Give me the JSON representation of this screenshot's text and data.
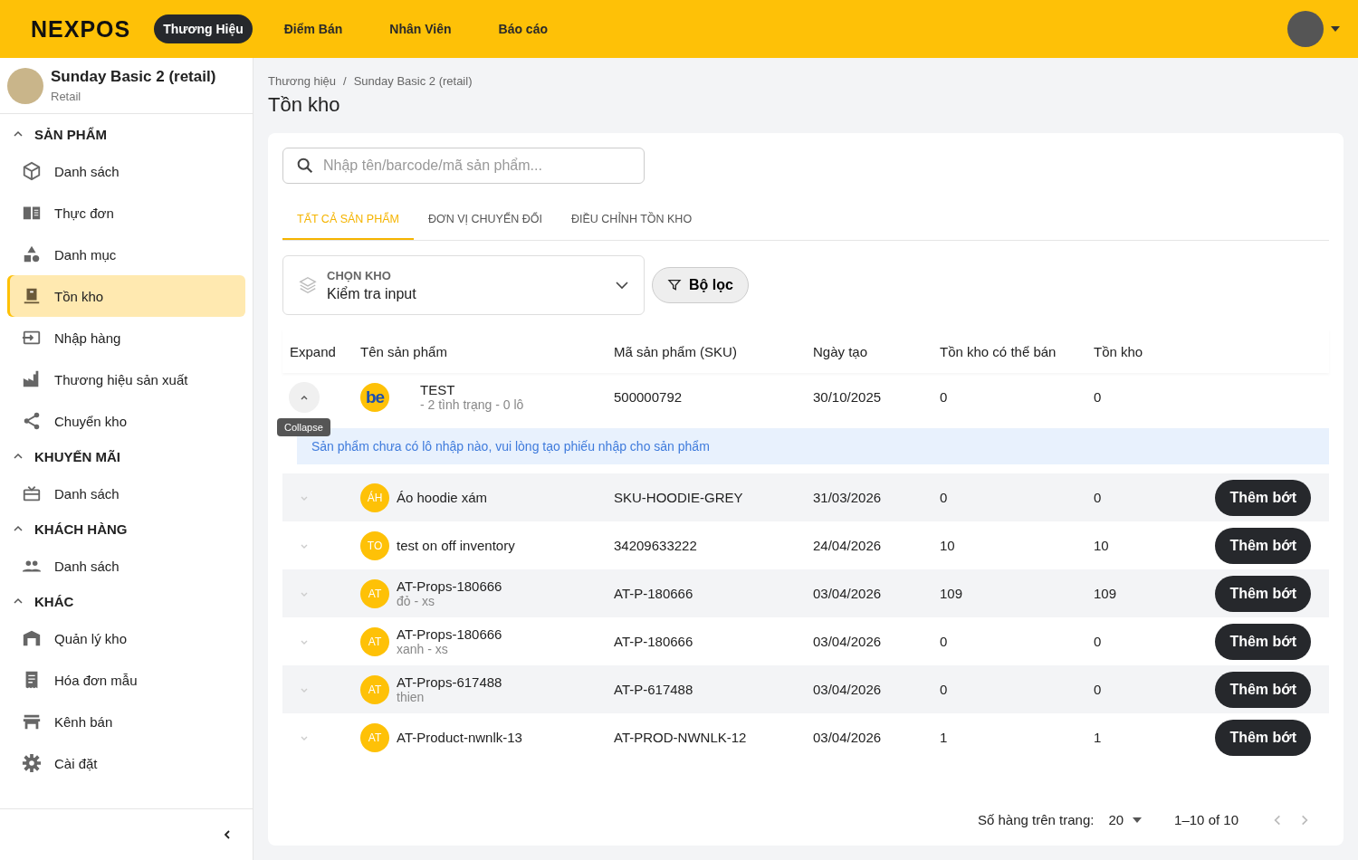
{
  "header": {
    "logo": "NEXPOS",
    "nav": [
      {
        "label": "Thương Hiệu",
        "selected": true
      },
      {
        "label": "Điểm Bán",
        "selected": false
      },
      {
        "label": "Nhân Viên",
        "selected": false
      },
      {
        "label": "Báo cáo",
        "selected": false
      }
    ]
  },
  "sidebar": {
    "store": {
      "name": "Sunday Basic 2 (retail)",
      "type": "Retail"
    },
    "sections": [
      {
        "title": "SẢN PHẨM",
        "expanded": true,
        "items": [
          {
            "label": "Danh sách",
            "selected": false
          },
          {
            "label": "Thực đơn",
            "selected": false
          },
          {
            "label": "Danh mục",
            "selected": false
          },
          {
            "label": "Tồn kho",
            "selected": true
          },
          {
            "label": "Nhập hàng",
            "selected": false
          },
          {
            "label": "Thương hiệu sản xuất",
            "selected": false
          },
          {
            "label": "Chuyển kho",
            "selected": false
          }
        ]
      },
      {
        "title": "KHUYẾN MÃI",
        "expanded": true,
        "items": [
          {
            "label": "Danh sách",
            "selected": false
          }
        ]
      },
      {
        "title": "KHÁCH HÀNG",
        "expanded": true,
        "items": [
          {
            "label": "Danh sách",
            "selected": false
          }
        ]
      },
      {
        "title": "KHÁC",
        "expanded": true,
        "items": [
          {
            "label": "Quản lý kho",
            "selected": false
          },
          {
            "label": "Hóa đơn mẫu",
            "selected": false
          },
          {
            "label": "Kênh bán",
            "selected": false
          },
          {
            "label": "Cài đặt",
            "selected": false
          }
        ]
      }
    ]
  },
  "breadcrumb": [
    "Thương hiệu",
    "Sunday Basic 2 (retail)"
  ],
  "breadcrumb_separator": "/",
  "page_title": "Tồn kho",
  "search": {
    "placeholder": "Nhập tên/barcode/mã sản phẩm..."
  },
  "tabs": [
    {
      "label": "TẤT CẢ SẢN PHẨM",
      "selected": true
    },
    {
      "label": "ĐƠN VỊ CHUYỂN ĐỔI",
      "selected": false
    },
    {
      "label": "ĐIỀU CHỈNH TỒN KHO",
      "selected": false
    }
  ],
  "warehouse_select": {
    "label": "CHỌN KHO",
    "value": "Kiểm tra input"
  },
  "filter_button": "Bộ lọc",
  "table": {
    "columns": [
      "Expand",
      "Tên sản phẩm",
      "Mã sản phẩm (SKU)",
      "Ngày tạo",
      "Tồn kho có thể bán",
      "Tồn kho"
    ],
    "tooltip": "Collapse",
    "rows": [
      {
        "expanded": true,
        "thumb": {
          "kind": "logo",
          "text": "be"
        },
        "name": "TEST",
        "variant": "- 2 tình trạng - 0 lô",
        "sku": "500000792",
        "created": "30/10/2025",
        "sellable": "0",
        "stock": "0",
        "detail": "Sản phẩm chưa có lô nhập nào, vui lòng tạo phiếu nhập cho sản phẩm"
      },
      {
        "expanded": false,
        "thumb": {
          "kind": "initials",
          "text": "ÁH"
        },
        "name": "Áo hoodie xám",
        "sku": "SKU-HOODIE-GREY",
        "created": "31/03/2026",
        "sellable": "0",
        "stock": "0",
        "action": "Thêm bớt"
      },
      {
        "expanded": false,
        "thumb": {
          "kind": "initials",
          "text": "TO"
        },
        "name": "test on off inventory",
        "sku": "34209633222",
        "created": "24/04/2026",
        "sellable": "10",
        "stock": "10",
        "action": "Thêm bớt"
      },
      {
        "expanded": false,
        "thumb": {
          "kind": "initials",
          "text": "AT"
        },
        "name": "AT-Props-180666",
        "variant": "đỏ - xs",
        "sku": "AT-P-180666",
        "created": "03/04/2026",
        "sellable": "109",
        "stock": "109",
        "action": "Thêm bớt"
      },
      {
        "expanded": false,
        "thumb": {
          "kind": "initials",
          "text": "AT"
        },
        "name": "AT-Props-180666",
        "variant": "xanh - xs",
        "sku": "AT-P-180666",
        "created": "03/04/2026",
        "sellable": "0",
        "stock": "0",
        "action": "Thêm bớt"
      },
      {
        "expanded": false,
        "thumb": {
          "kind": "initials",
          "text": "AT"
        },
        "name": "AT-Props-617488",
        "variant": "thien",
        "sku": "AT-P-617488",
        "created": "03/04/2026",
        "sellable": "0",
        "stock": "0",
        "action": "Thêm bớt"
      },
      {
        "expanded": false,
        "thumb": {
          "kind": "initials",
          "text": "AT"
        },
        "name": "AT-Product-nwnlk-13",
        "sku": "AT-PROD-NWNLK-12",
        "created": "03/04/2026",
        "sellable": "1",
        "stock": "1",
        "action": "Thêm bớt"
      }
    ]
  },
  "pagination": {
    "rows_per_page_label": "Số hàng trên trang:",
    "rows_per_page": "20",
    "range": "1–10 of 10"
  }
}
